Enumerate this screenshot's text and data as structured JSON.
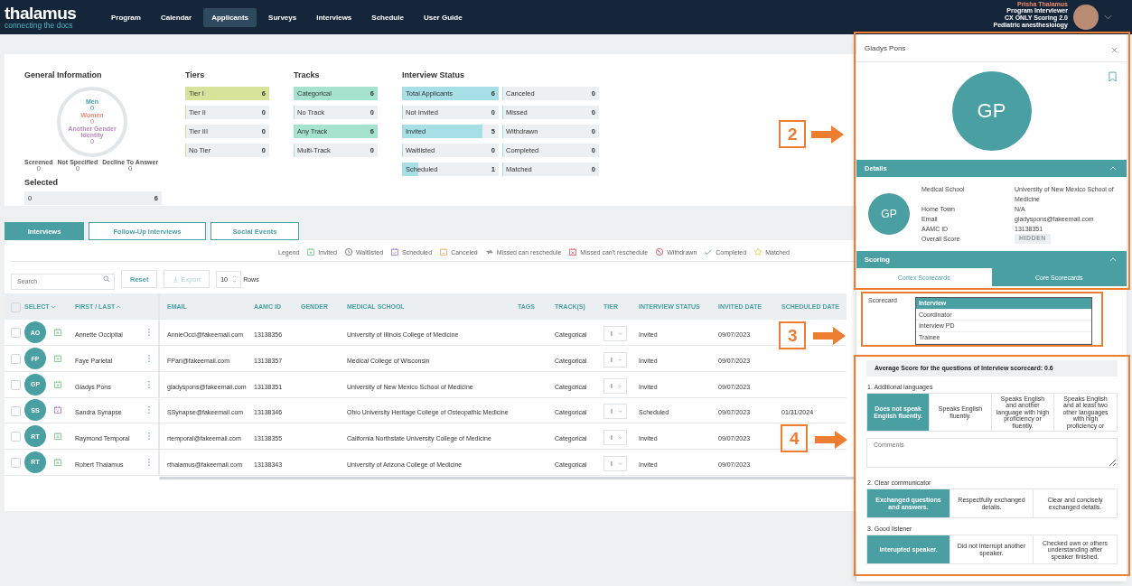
{
  "header": {
    "logo": "thalamus",
    "tagline": "connecting the docs",
    "nav": [
      {
        "label": "Program",
        "selected": false
      },
      {
        "label": "Calendar",
        "selected": false
      },
      {
        "label": "Applicants",
        "selected": true
      },
      {
        "label": "Surveys",
        "selected": false
      },
      {
        "label": "Interviews",
        "selected": false
      },
      {
        "label": "Schedule",
        "selected": false
      },
      {
        "label": "User Guide",
        "selected": false
      }
    ],
    "user": {
      "name": "Prisha Thalamus",
      "lines": [
        "Program Interviewer",
        "CX ONLY Scoring 2.0",
        "Pediatric anesthesiology"
      ]
    }
  },
  "general_information": {
    "title": "General Information",
    "gender": [
      {
        "label": "Men",
        "count": "0"
      },
      {
        "label": "Women",
        "count": "0"
      },
      {
        "label": "Another Gender Identity",
        "count": "0"
      }
    ],
    "other": [
      {
        "label": "Screened",
        "count": "0"
      },
      {
        "label": "Not Specified",
        "count": "0"
      },
      {
        "label": "Decline To Answer",
        "count": "0"
      }
    ],
    "selected": {
      "title": "Selected",
      "value": "0",
      "total": "6"
    }
  },
  "tiers": {
    "title": "Tiers",
    "items": [
      {
        "label": "Tier I",
        "count": "6",
        "level": 1
      },
      {
        "label": "Tier II",
        "count": "0",
        "level": 0
      },
      {
        "label": "Tier III",
        "count": "0",
        "level": 0
      },
      {
        "label": "No Tier",
        "count": "0",
        "level": 0
      }
    ]
  },
  "tracks": {
    "title": "Tracks",
    "items": [
      {
        "label": "Categorical",
        "count": "6",
        "level": 1
      },
      {
        "label": "No Track",
        "count": "0",
        "level": 0
      },
      {
        "label": "Any Track",
        "count": "6",
        "level": 1
      },
      {
        "label": "Multi-Track",
        "count": "0",
        "level": 0
      }
    ]
  },
  "interview_status": {
    "title": "Interview Status",
    "items": [
      {
        "label": "Total Applicants",
        "count": "6",
        "level": 1
      },
      {
        "label": "Not Invited",
        "count": "0",
        "level": 0
      },
      {
        "label": "Invited",
        "count": "5",
        "level": 0.83
      },
      {
        "label": "Waitlisted",
        "count": "0",
        "level": 0
      },
      {
        "label": "Scheduled",
        "count": "1",
        "level": 0.17
      },
      {
        "label": "Canceled",
        "count": "0",
        "level": 0
      },
      {
        "label": "Missed",
        "count": "0",
        "level": 0
      },
      {
        "label": "Withdrawn",
        "count": "0",
        "level": 0
      },
      {
        "label": "Completed",
        "count": "0",
        "level": 0
      },
      {
        "label": "Matched",
        "count": "0",
        "level": 0
      }
    ]
  },
  "tabs": [
    {
      "label": "Interviews",
      "selected": true
    },
    {
      "label": "Follow-Up Interviews",
      "selected": false
    },
    {
      "label": "Social Events",
      "selected": false
    }
  ],
  "legend": {
    "title": "Legend",
    "items": [
      {
        "kind": "invited",
        "label": "Invited"
      },
      {
        "kind": "waitlisted",
        "label": "Waitlisted"
      },
      {
        "kind": "scheduled",
        "label": "Scheduled"
      },
      {
        "kind": "canceled",
        "label": "Canceled"
      },
      {
        "kind": "missed_reschedule",
        "label": "Missed can reschedule"
      },
      {
        "kind": "missed_no_reschedule",
        "label": "Missed can't reschedule"
      },
      {
        "kind": "withdrawn",
        "label": "Withdrawn"
      },
      {
        "kind": "completed",
        "label": "Completed"
      },
      {
        "kind": "matched",
        "label": "Matched"
      }
    ]
  },
  "toolbar": {
    "search_placeholder": "Search",
    "reset": "Reset",
    "export": "Export",
    "export_disabled": true,
    "rows_value": "10",
    "rows_label": "Rows"
  },
  "table": {
    "select_all_checked": false,
    "columns": [
      "SELECT",
      "FIRST / LAST",
      "EMAIL",
      "AAMC ID",
      "GENDER",
      "MEDICAL SCHOOL",
      "TAGS",
      "TRACK(S)",
      "TIER",
      "INTERVIEW STATUS",
      "INVITED DATE",
      "SCHEDULED DATE"
    ],
    "rows": [
      {
        "checked": false,
        "initials": "AO",
        "kind": "invited",
        "name": "Annette Occipital",
        "email": "AnnieOcci@fakeemail.com",
        "aamc_id": "13138356",
        "medical_school": "University of Illinois College of Medicine",
        "track": "Categorical",
        "tier": "I",
        "status": "Invited",
        "invited_date": "09/07/2023",
        "scheduled_date": ""
      },
      {
        "checked": false,
        "initials": "FP",
        "kind": "invited",
        "name": "Faye Parietal",
        "email": "FPari@fakeemail.com",
        "aamc_id": "13138357",
        "medical_school": "Medical College of Wisconsin",
        "track": "Categorical",
        "tier": "I",
        "status": "Invited",
        "invited_date": "09/07/2023",
        "scheduled_date": ""
      },
      {
        "checked": false,
        "initials": "GP",
        "kind": "invited",
        "name": "Gladys Pons",
        "email": "gladyspons@fakeemail.com",
        "aamc_id": "13138351",
        "medical_school": "University of New Mexico School of Medicine",
        "track": "Categorical",
        "tier": "I",
        "status": "Invited",
        "invited_date": "09/07/2023",
        "scheduled_date": ""
      },
      {
        "checked": false,
        "initials": "SS",
        "kind": "scheduled",
        "name": "Sandra Synapse",
        "email": "SSynapse@fakeemail.com",
        "aamc_id": "13138346",
        "medical_school": "Ohio University Heritage College of Osteopathic Medicine",
        "track": "Categorical",
        "tier": "I",
        "status": "Scheduled",
        "invited_date": "09/07/2023",
        "scheduled_date": "01/31/2024"
      },
      {
        "checked": false,
        "initials": "RT",
        "kind": "invited",
        "name": "Raymond Temporal",
        "email": "rtemporal@fakeemail.com",
        "aamc_id": "13138355",
        "medical_school": "California Northstate University College of Medicine",
        "track": "Categorical",
        "tier": "I",
        "status": "Invited",
        "invited_date": "09/07/2023",
        "scheduled_date": ""
      },
      {
        "checked": false,
        "initials": "RT",
        "kind": "invited",
        "name": "Robert Thalamus",
        "email": "rthalamus@fakeemail.com",
        "aamc_id": "13138343",
        "medical_school": "University of Arizona College of Medicine",
        "track": "Categorical",
        "tier": "I",
        "status": "Invited",
        "invited_date": "09/07/2023",
        "scheduled_date": ""
      }
    ]
  },
  "panel": {
    "title": "Gladys Pons",
    "initials": "GP",
    "details_initials": "GP",
    "details": {
      "title": "Details",
      "fields": [
        {
          "label": "Medical School",
          "value": "University of New Mexico School of Medicine"
        },
        {
          "label": "Home Town",
          "value": "N/A"
        },
        {
          "label": "Email",
          "value": "gladyspons@fakeemail.com"
        },
        {
          "label": "AAMC ID",
          "value": "13138351"
        },
        {
          "label": "Overall Score",
          "value": "HIDDEN",
          "kind": "badge"
        }
      ]
    },
    "scoring": {
      "title": "Scoring",
      "tabs": [
        {
          "label": "Cortex Scorecards",
          "selected": false
        },
        {
          "label": "Core Scorecards",
          "selected": true
        }
      ],
      "scorecard_label": "Scorecard",
      "scorecards": [
        {
          "label": "Interview",
          "selected": true
        },
        {
          "label": "Coordinator",
          "selected": false
        },
        {
          "label": "Interview PD",
          "selected": false
        },
        {
          "label": "Trainee",
          "selected": false
        }
      ],
      "average": "Average Score for the questions of Interview scorecard:  0.6",
      "comments_placeholder": "Comments",
      "questions": [
        {
          "title": "1. Additional languages",
          "options": [
            {
              "label": "Does not speak English fluently.",
              "selected": true
            },
            {
              "label": "Speaks English fluently.",
              "selected": false
            },
            {
              "label": "Speaks English and another language with high proficiency or fluently.",
              "selected": false
            },
            {
              "label": "Speaks English and at least two other languages with high proficiency or",
              "selected": false
            }
          ]
        },
        {
          "title": "2. Clear communicator",
          "options": [
            {
              "label": "Exchanged questions and answers.",
              "selected": true
            },
            {
              "label": "Respectfully exchanged details.",
              "selected": false
            },
            {
              "label": "Clear and concisely exchanged details.",
              "selected": false
            }
          ]
        },
        {
          "title": "3. Good listener",
          "options": [
            {
              "label": "Interupted speaker.",
              "selected": true
            },
            {
              "label": "Did not interrupt another speaker.",
              "selected": false
            },
            {
              "label": "Checked own or others understanding after speaker finished.",
              "selected": false
            }
          ]
        }
      ]
    }
  },
  "annotations": [
    {
      "number": "2"
    },
    {
      "number": "3"
    },
    {
      "number": "4"
    }
  ]
}
